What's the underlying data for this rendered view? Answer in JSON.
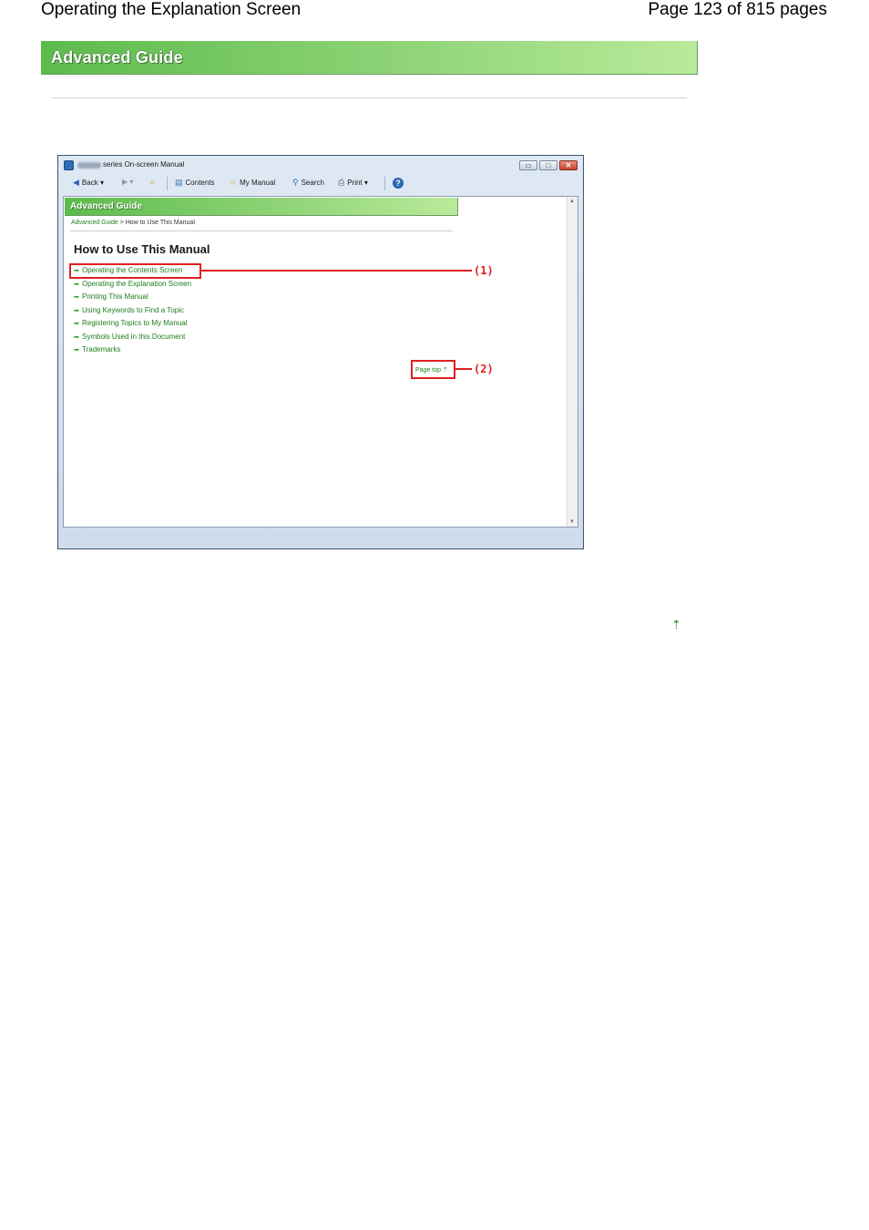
{
  "header": {
    "title": "Operating the Explanation Screen",
    "page_info": "Page 123 of 815 pages"
  },
  "banner": {
    "label": "Advanced Guide"
  },
  "screenshot": {
    "window_title": "series On-screen Manual",
    "window_controls": {
      "minimize": "▭",
      "maximize": "□",
      "close": "✕"
    },
    "toolbar": {
      "back": "Back",
      "contents": "Contents",
      "my_manual": "My Manual",
      "search": "Search",
      "print": "Print"
    },
    "inner_banner": "Advanced Guide",
    "breadcrumb": {
      "link": "Advanced Guide",
      "separator": " > ",
      "current": "How to Use This Manual"
    },
    "heading": "How to Use This Manual",
    "links": [
      "Operating the Contents Screen",
      "Operating the Explanation Screen",
      "Printing This Manual",
      "Using Keywords to Find a Topic",
      "Registering Topics to My Manual",
      "Symbols Used in this Document",
      "Trademarks"
    ],
    "page_top": "Page top ⇡",
    "callouts": {
      "one": "(1)",
      "two": "(2)"
    }
  },
  "page_top_icon": "⇡"
}
